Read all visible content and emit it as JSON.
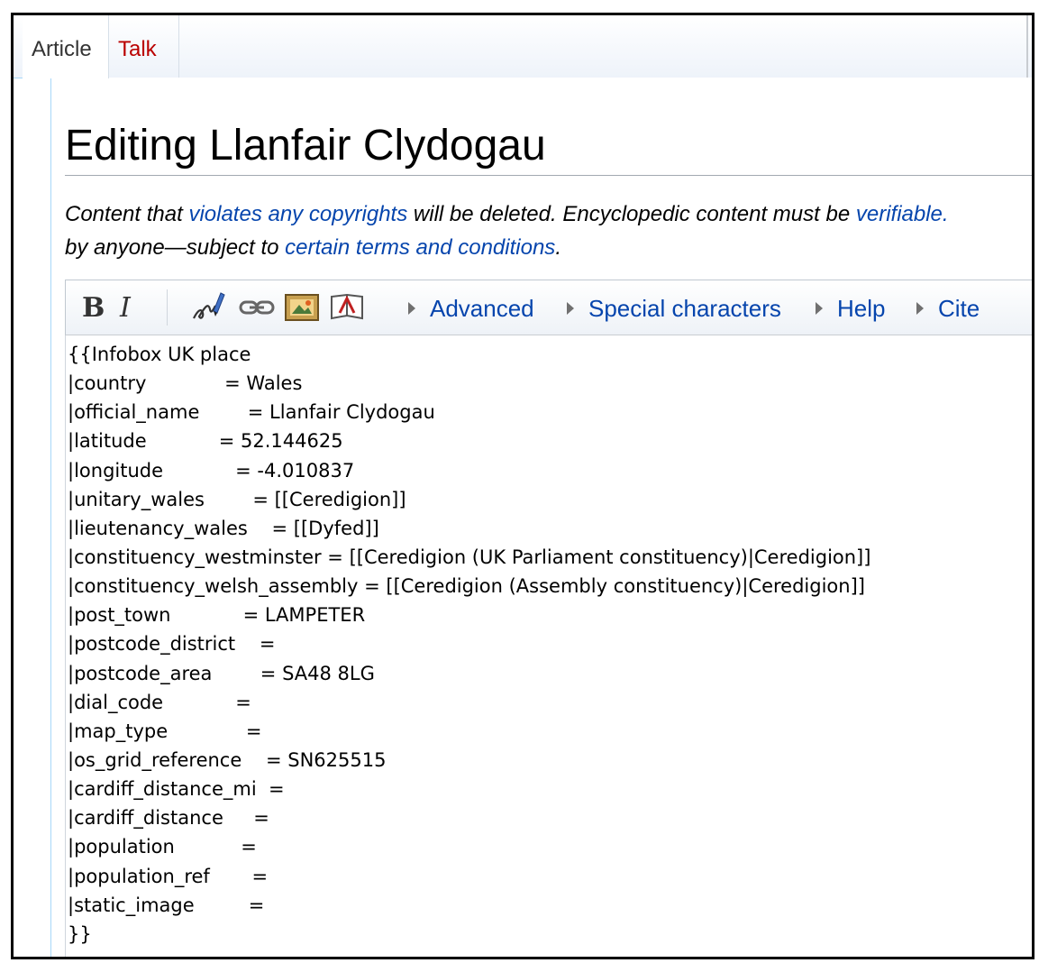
{
  "tabs": {
    "article": "Article",
    "talk": "Talk"
  },
  "page_title": "Editing Llanfair Clydogau",
  "notice": {
    "line1_part1": "Content that ",
    "line1_link1": "violates any copyrights",
    "line1_part2": " will be deleted. Encyclopedic content must be ",
    "line1_link2": "verifiable.",
    "line2_part1": "by anyone—subject to ",
    "line2_link": "certain terms and conditions",
    "line2_part2": "."
  },
  "toolbar": {
    "bold": "B",
    "italic": "I",
    "sections": {
      "advanced": "Advanced",
      "special_characters": "Special characters",
      "help": "Help",
      "cite": "Cite"
    },
    "icons": [
      "signature-icon",
      "link-icon",
      "image-icon",
      "reference-icon",
      "triangle-right-icon"
    ]
  },
  "editor": {
    "lines": [
      "{{Infobox UK place",
      "|country             = Wales",
      "|official_name        = Llanfair Clydogau",
      "|latitude            = 52.144625",
      "|longitude            = -4.010837",
      "|unitary_wales        = [[Ceredigion]]",
      "|lieutenancy_wales    = [[Dyfed]]",
      "|constituency_westminster = [[Ceredigion (UK Parliament constituency)|Ceredigion]]",
      "|constituency_welsh_assembly = [[Ceredigion (Assembly constituency)|Ceredigion]]",
      "|post_town            = LAMPETER",
      "|postcode_district    =",
      "|postcode_area        = SA48 8LG",
      "|dial_code            =",
      "|map_type             =",
      "|os_grid_reference    = SN625515",
      "|cardiff_distance_mi  =",
      "|cardiff_distance     =",
      "|population           =",
      "|population_ref       =",
      "|static_image         =",
      "}}"
    ]
  },
  "colors": {
    "link": "#0645ad",
    "talk_tab": "#ba0000",
    "border": "#a7d7f9"
  }
}
